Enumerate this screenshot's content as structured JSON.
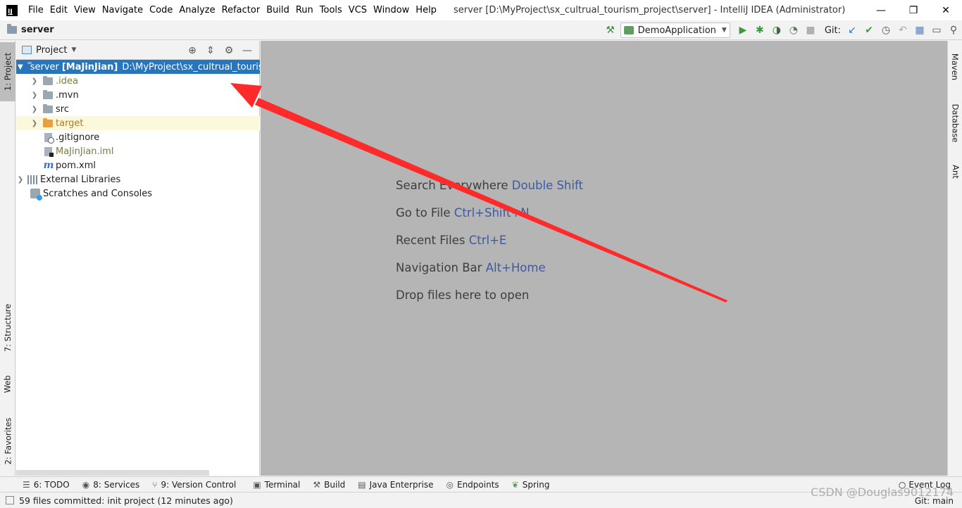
{
  "titlebar": {
    "logo": "IJ",
    "menu": [
      "File",
      "Edit",
      "View",
      "Navigate",
      "Code",
      "Analyze",
      "Refactor",
      "Build",
      "Run",
      "Tools",
      "VCS",
      "Window",
      "Help"
    ],
    "window_title": "server [D:\\MyProject\\sx_cultrual_tourism_project\\server] - IntelliJ IDEA (Administrator)",
    "controls": {
      "minimize": "—",
      "restore": "❐",
      "close": "✕"
    }
  },
  "navbar": {
    "title": "server",
    "run_config": "DemoApplication",
    "git_label": "Git:"
  },
  "left_stripe": {
    "project_tab": "1: Project",
    "structure_tab": "7: Structure",
    "web_tab": "Web",
    "favorites_tab": "2: Favorites"
  },
  "right_stripe": {
    "maven_tab": "Maven",
    "database_tab": "Database",
    "ant_tab": "Ant"
  },
  "project_panel": {
    "title": "Project",
    "tree": {
      "root_name": "server",
      "root_module": "[MaJinJian]",
      "root_path": "D:\\MyProject\\sx_cultrual_tourism",
      "idea": ".idea",
      "mvn": ".mvn",
      "src": "src",
      "target": "target",
      "gitignore": ".gitignore",
      "iml": "MaJinJian.iml",
      "pom": "pom.xml",
      "external_libraries": "External Libraries",
      "scratches": "Scratches and Consoles"
    }
  },
  "editor": {
    "hints": [
      {
        "text": "Search Everywhere",
        "key": "Double Shift"
      },
      {
        "text": "Go to File",
        "key": "Ctrl+Shift+N"
      },
      {
        "text": "Recent Files",
        "key": "Ctrl+E"
      },
      {
        "text": "Navigation Bar",
        "key": "Alt+Home"
      },
      {
        "text": "Drop files here to open",
        "key": ""
      }
    ]
  },
  "bottom_tools": {
    "todo": "6: TODO",
    "services": "8: Services",
    "version_control": "9: Version Control",
    "terminal": "Terminal",
    "build": "Build",
    "java_enterprise": "Java Enterprise",
    "endpoints": "Endpoints",
    "spring": "Spring",
    "event_log": "Event Log"
  },
  "status": {
    "message": "59 files committed: init project (12 minutes ago)",
    "branch": "Git: main",
    "watermark": "CSDN @Douglas9012174"
  },
  "colors": {
    "selection": "#2675bf",
    "editor_bg": "#b5b5b5",
    "shortcut": "#3e5a9e",
    "annotation": "#ff2a2a"
  }
}
